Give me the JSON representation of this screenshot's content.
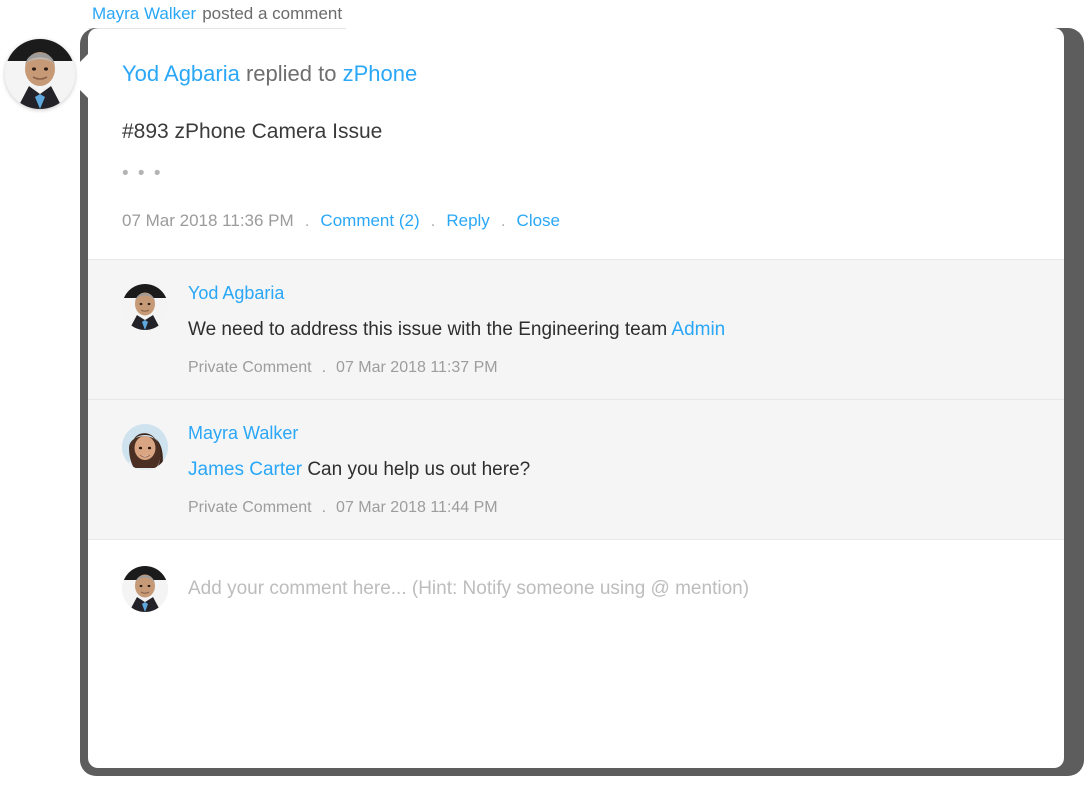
{
  "banner": {
    "actor": "Mayra Walker",
    "action": "posted a comment"
  },
  "card": {
    "header": {
      "author": "Yod Agbaria",
      "verb": "replied to",
      "target": "zPhone"
    },
    "ticket_title": "#893 zPhone Camera Issue",
    "ellipsis": "• • •",
    "meta": {
      "timestamp": "07 Mar 2018 11:36 PM",
      "dot1": ".",
      "comment_action": "Comment (2)",
      "dot2": ".",
      "reply_action": "Reply",
      "dot3": ".",
      "close_action": "Close"
    },
    "comments": [
      {
        "author": "Yod Agbaria",
        "avatar": "male-avatar",
        "text": "We need to address this issue with the Engineering team ",
        "mention": "Admin",
        "mention_position": "end",
        "visibility": "Private Comment",
        "dot": ".",
        "timestamp": "07 Mar 2018 11:37 PM"
      },
      {
        "author": "Mayra Walker",
        "avatar": "female-avatar",
        "text": "Can you help us out here?",
        "mention": "James Carter",
        "mention_position": "start",
        "visibility": "Private Comment",
        "dot": ".",
        "timestamp": "07 Mar 2018 11:44 PM"
      }
    ],
    "composer": {
      "avatar": "male-avatar",
      "value": "",
      "placeholder": "Add your comment here... (Hint: Notify someone using @ mention)"
    }
  },
  "colors": {
    "link_blue": "#2aa7f7",
    "muted_text": "#9b9b9b",
    "body_text": "#2e2e2e",
    "comment_bg": "#f5f5f5",
    "card_bg": "#ffffff",
    "shadow": "#5d5d5d"
  }
}
